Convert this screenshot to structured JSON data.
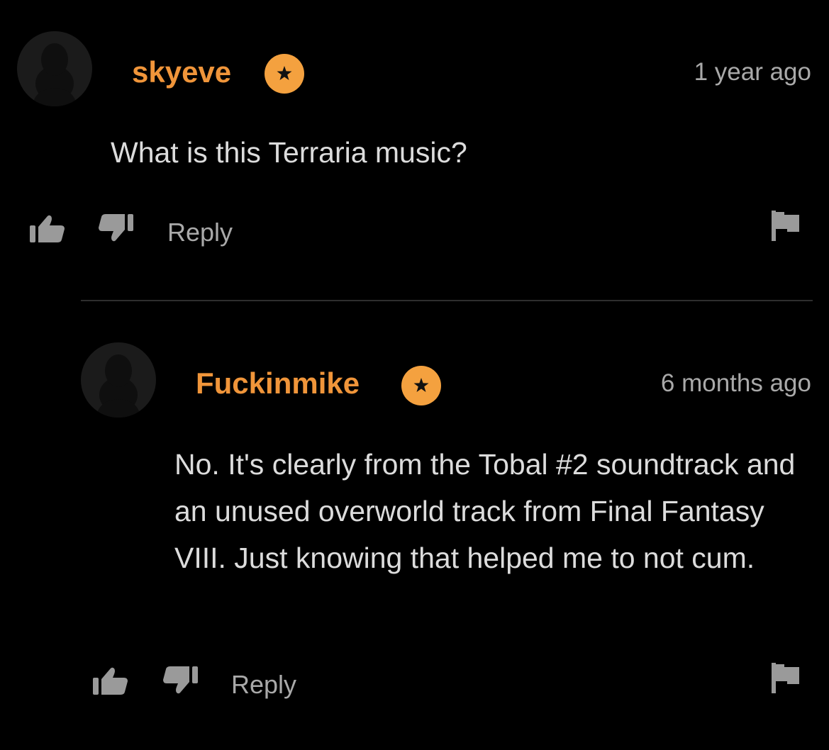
{
  "comments": [
    {
      "username": "skyeve",
      "timestamp": "1 year ago",
      "text": "What is this Terraria music?",
      "reply_label": "Reply"
    },
    {
      "username": "Fuckinmike",
      "timestamp": "6 months ago",
      "text": "No. It's clearly from the Tobal #2 soundtrack and an unused overworld track from Final Fantasy VIII. Just knowing that helped me to not cum.",
      "reply_label": "Reply"
    }
  ],
  "colors": {
    "background": "#000000",
    "username": "#f0953a",
    "badge": "#f4a13f",
    "text": "#dcdcdc",
    "muted": "#a9a9a9"
  },
  "icons": {
    "avatar": "default-user-silhouette",
    "badge": "star-badge",
    "like": "thumbs-up",
    "dislike": "thumbs-down",
    "flag": "flag"
  }
}
